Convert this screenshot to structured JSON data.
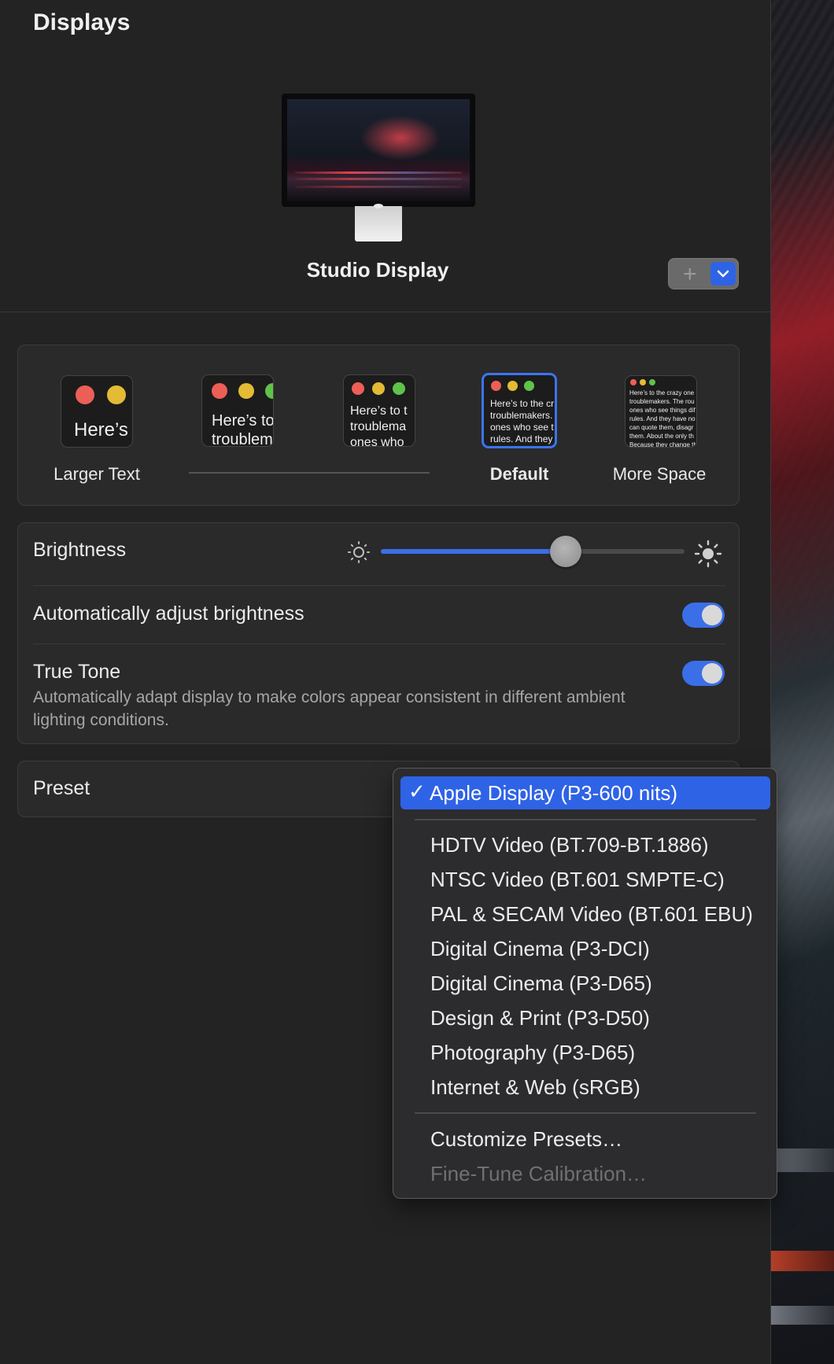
{
  "window": {
    "title": "Displays"
  },
  "display": {
    "name": "Studio Display",
    "add_button": "+",
    "dropdown_icon": "chevron-down-icon"
  },
  "resolution": {
    "options": [
      {
        "label": "Larger Text",
        "preview": "Here’s"
      },
      {
        "label": "",
        "preview_line1": "Here’s to",
        "preview_line2": "troublem"
      },
      {
        "label": "",
        "preview_line1": "Here’s to t",
        "preview_line2": "troublema",
        "preview_line3": "ones who"
      },
      {
        "label": "Default",
        "preview_line1": "Here’s to the cr",
        "preview_line2": "troublemakers.",
        "preview_line3": "ones who see t",
        "preview_line4": "rules. And they"
      },
      {
        "label": "More Space",
        "preview_lines": [
          "Here’s to the crazy one",
          "troublemakers. The rou",
          "ones who see things dif",
          "rules. And they have no",
          "can quote them, disagr",
          "them. About the only th",
          "Because they change th"
        ]
      }
    ],
    "selected": "Default"
  },
  "brightness": {
    "label": "Brightness",
    "value_percent": 61,
    "min_icon": "sun-small-icon",
    "max_icon": "sun-large-icon"
  },
  "auto_brightness": {
    "label": "Automatically adjust brightness",
    "enabled": true
  },
  "true_tone": {
    "label": "True Tone",
    "description": "Automatically adapt display to make colors appear consistent in different ambient lighting conditions.",
    "enabled": true
  },
  "preset": {
    "label": "Preset",
    "menu": {
      "selected": "Apple Display (P3-600 nits)",
      "check": "✓",
      "items": [
        "HDTV Video (BT.709-BT.1886)",
        "NTSC Video (BT.601 SMPTE-C)",
        "PAL & SECAM Video (BT.601 EBU)",
        "Digital Cinema (P3-DCI)",
        "Digital Cinema (P3-D65)",
        "Design & Print (P3-D50)",
        "Photography (P3-D65)",
        "Internet & Web (sRGB)"
      ],
      "customize": "Customize Presets…",
      "fine_tune": "Fine-Tune Calibration…"
    }
  },
  "colors": {
    "accent": "#2f63e6",
    "traffic_red": "#ec5f57",
    "traffic_yellow": "#e3bb34",
    "traffic_green": "#5fc34a"
  }
}
